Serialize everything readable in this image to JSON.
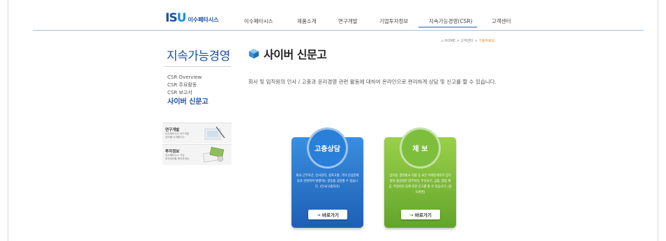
{
  "brand": {
    "mark_i": "I",
    "mark_s": "S",
    "mark_u": "U",
    "name": "이수페타시스"
  },
  "nav": [
    "이수페타시스",
    "제품소개",
    "연구개발",
    "기업투자정보",
    "지속가능경영(CSR)",
    "고객센터"
  ],
  "breadcrumb": {
    "home": "HOME",
    "sep1": ">",
    "level1": "고객센터",
    "sep2": ">",
    "current": "기술자료실"
  },
  "sidebar": {
    "title": "지속가능경영",
    "items": [
      {
        "label": "CSR Overview"
      },
      {
        "label": "CSR 주요활동"
      },
      {
        "label": "CSR 보고서"
      },
      {
        "label": "사이버 신문고"
      }
    ],
    "boxes": [
      {
        "title": "연구개발",
        "line1": "이수페타시스 연구개발",
        "line2": "분야를 소개합니다."
      },
      {
        "title": "투자정보",
        "line1": "이수페타시스 기업",
        "line2": "투자정보를 확인하세요."
      }
    ]
  },
  "main": {
    "title": "사이버 신문고",
    "intro": "회사 및 임직원의 인사 / 고충과 윤리경영 관련 활동에 대하여 온라인으로 편리하게 상담 및 신고를 할 수 있습니다."
  },
  "cards": [
    {
      "title": "고충상담",
      "desc": "회사 근무조건, 인사관리, 성차고충, 기타 신상문제 등과 관련하여 발생하는 갈등을 상담할 수 있습니다. (인사/고충처리)",
      "button": "바로가기"
    },
    {
      "title": "제 보",
      "desc": "임직원, 협력회사 직원 등 모든 이해관계자가 임직원의 불공정한 업무처리, 부당요구, 금품, 향응 제공, 부정비리 등에 대한 신고를 할 수 있습니다. (윤리경영)",
      "button": "바로가기"
    }
  ],
  "colors": {
    "brand_blue": "#1a4fa3",
    "card_blue": "#2a7fd8",
    "card_green": "#7dbf3d",
    "crumb_current": "#e08a2a"
  }
}
